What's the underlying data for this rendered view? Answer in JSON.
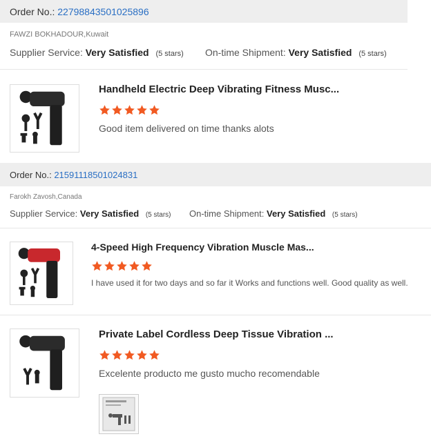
{
  "reviews": [
    {
      "order_label": "Order No.:",
      "order_number": "22798843501025896",
      "buyer": "FAWZI BOKHADOUR,Kuwait",
      "supplier_label": "Supplier Service:",
      "supplier_value": "Very Satisfied",
      "supplier_stars": "(5 stars)",
      "shipment_label": "On-time Shipment:",
      "shipment_value": "Very Satisfied",
      "shipment_stars": "(5 stars)",
      "product_title": "Handheld Electric Deep Vibrating Fitness Musc...",
      "rating": 5,
      "text": "Good item delivered on time thanks alots",
      "gun_color": "#2b2b2b"
    },
    {
      "order_label": "Order No.:",
      "order_number": "21591118501024831",
      "buyer": "Farokh Zavosh,Canada",
      "supplier_label": "Supplier Service:",
      "supplier_value": "Very Satisfied",
      "supplier_stars": "(5 stars)",
      "shipment_label": "On-time Shipment:",
      "shipment_value": "Very Satisfied",
      "shipment_stars": "(5 stars)",
      "product_title": "4-Speed High Frequency Vibration Muscle Mas...",
      "rating": 5,
      "text": "I have used it for two days and so far it Works and functions well. Good quality as well.",
      "gun_color": "#c8282d"
    },
    {
      "product_title": "Private Label Cordless Deep Tissue Vibration ...",
      "rating": 5,
      "text": "Excelente producto me gusto mucho recomendable",
      "gun_color": "#2b2b2b"
    }
  ],
  "colors": {
    "star": "#f15a22",
    "link": "#2a6fc4",
    "order_bar": "#eeeeee"
  }
}
